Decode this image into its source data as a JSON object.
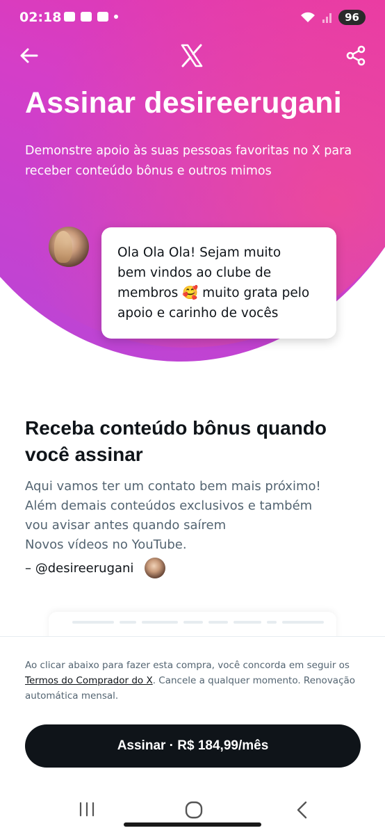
{
  "status_bar": {
    "time": "02:18",
    "battery": "96"
  },
  "header": {
    "back_icon": "arrow-left-icon",
    "logo_icon": "x-logo-icon",
    "share_icon": "share-icon"
  },
  "hero": {
    "title": "Assinar desireerugani",
    "subtitle": "Demonstre apoio às suas pessoas favoritas no X para receber conteúdo bônus e outros mimos",
    "message_lines": [
      "Ola Ola Ola! Sejam muito",
      "bem vindos ao clube de",
      "membros 🥰 muito grata pelo",
      "apoio e carinho de vocês"
    ],
    "colors": {
      "gradient_start": "#ec2d8a",
      "gradient_end": "#b646d8"
    }
  },
  "benefits": {
    "title": "Receba conteúdo bônus quando você assinar",
    "description": "Aqui vamos ter um contato bem mais próximo!\nAlém demais conteúdos exclusivos e também\nvou avisar antes quando saírem\nNovos vídeos no YouTube.",
    "signature": "– @desireerugani"
  },
  "footer": {
    "terms_prefix": "Ao clicar abaixo para fazer esta compra, você concorda em seguir os ",
    "terms_link": "Termos do Comprador do X",
    "terms_suffix": ". Cancele a qualquer momento. Renovação automática mensal.",
    "cta_label": "Assinar · R$ 184,99/mês"
  }
}
